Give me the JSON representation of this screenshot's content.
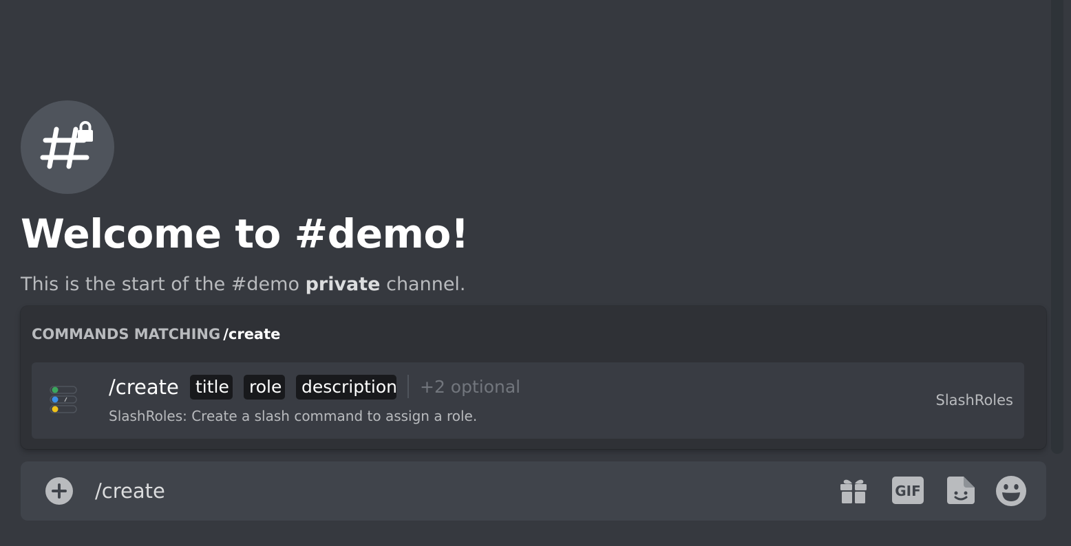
{
  "welcome": {
    "title": "Welcome to #demo!",
    "subtitle_prefix": "This is the start of the #demo",
    "subtitle_bold": "private",
    "subtitle_suffix": "channel."
  },
  "autocomplete": {
    "header_label": "COMMANDS MATCHING",
    "query": "/create",
    "commands": [
      {
        "name": "/create",
        "options": [
          "title",
          "role",
          "description"
        ],
        "optional_count": "+2 optional",
        "description": "SlashRoles: Create a slash command to assign a role.",
        "source": "SlashRoles"
      }
    ]
  },
  "composer": {
    "value": "/create",
    "buttons": {
      "gift": "gift-icon",
      "gif": "GIF",
      "sticker": "sticker-icon",
      "emoji": "emoji-icon"
    }
  },
  "colors": {
    "background": "#36393f",
    "popup": "#2f3136",
    "row_selected": "#393c43",
    "composer": "#40444b",
    "icon_gray": "#b9bbbe",
    "app_icon_green": "#3ba55d",
    "app_icon_blue": "#3b8ee6",
    "app_icon_yellow": "#f0c21a"
  }
}
